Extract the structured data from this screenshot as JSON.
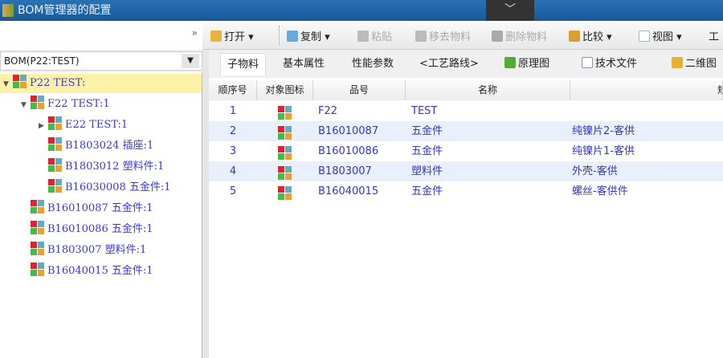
{
  "window": {
    "title": "BOM管理器的配置",
    "collapse_icon": "chevron-down"
  },
  "toolbar": {
    "more": "»",
    "open": "打开 ▾",
    "copy": "复制 ▾",
    "paste": "粘贴",
    "remove": "移去物料",
    "delete": "删除物料",
    "compare": "比较 ▾",
    "view": "视图 ▾",
    "tools": "工"
  },
  "selector": {
    "value": "BOM(P22:TEST)",
    "arrow": "▼"
  },
  "tree": [
    {
      "label": "P22 TEST:",
      "toggle": "▼",
      "level": 0
    },
    {
      "label": "F22 TEST:1",
      "toggle": "▼",
      "level": 1
    },
    {
      "label": "E22 TEST:1",
      "toggle": "▶",
      "level": 2
    },
    {
      "label": "B1803024 插座:1",
      "toggle": "",
      "level": 2
    },
    {
      "label": "B1803012 塑料件:1",
      "toggle": "",
      "level": 2
    },
    {
      "label": "B16030008 五金件:1",
      "toggle": "",
      "level": 2
    },
    {
      "label": "B16010087 五金件:1",
      "toggle": "",
      "level": 1
    },
    {
      "label": "B16010086 五金件:1",
      "toggle": "",
      "level": 1
    },
    {
      "label": "B1803007 塑料件:1",
      "toggle": "",
      "level": 1
    },
    {
      "label": "B16040015 五金件:1",
      "toggle": "",
      "level": 1
    }
  ],
  "tabs": [
    "子物料",
    "基本属性",
    "性能参数",
    "<工艺路线>",
    "原理图",
    "技术文件",
    "二维图"
  ],
  "table": {
    "columns": [
      "顺序号",
      "对象图标",
      "品号",
      "名称",
      "",
      "规格"
    ],
    "rows": [
      {
        "seq": "1",
        "code": "F22",
        "name": "TEST",
        "spec": ""
      },
      {
        "seq": "2",
        "code": "B16010087",
        "name": "五金件",
        "spec": "纯镍片2-客供"
      },
      {
        "seq": "3",
        "code": "B16010086",
        "name": "五金件",
        "spec": "纯镍片1-客供"
      },
      {
        "seq": "4",
        "code": "B1803007",
        "name": "塑料件",
        "spec": "外壳-客供"
      },
      {
        "seq": "5",
        "code": "B16040015",
        "name": "五金件",
        "spec": "螺丝-客供件"
      }
    ]
  }
}
